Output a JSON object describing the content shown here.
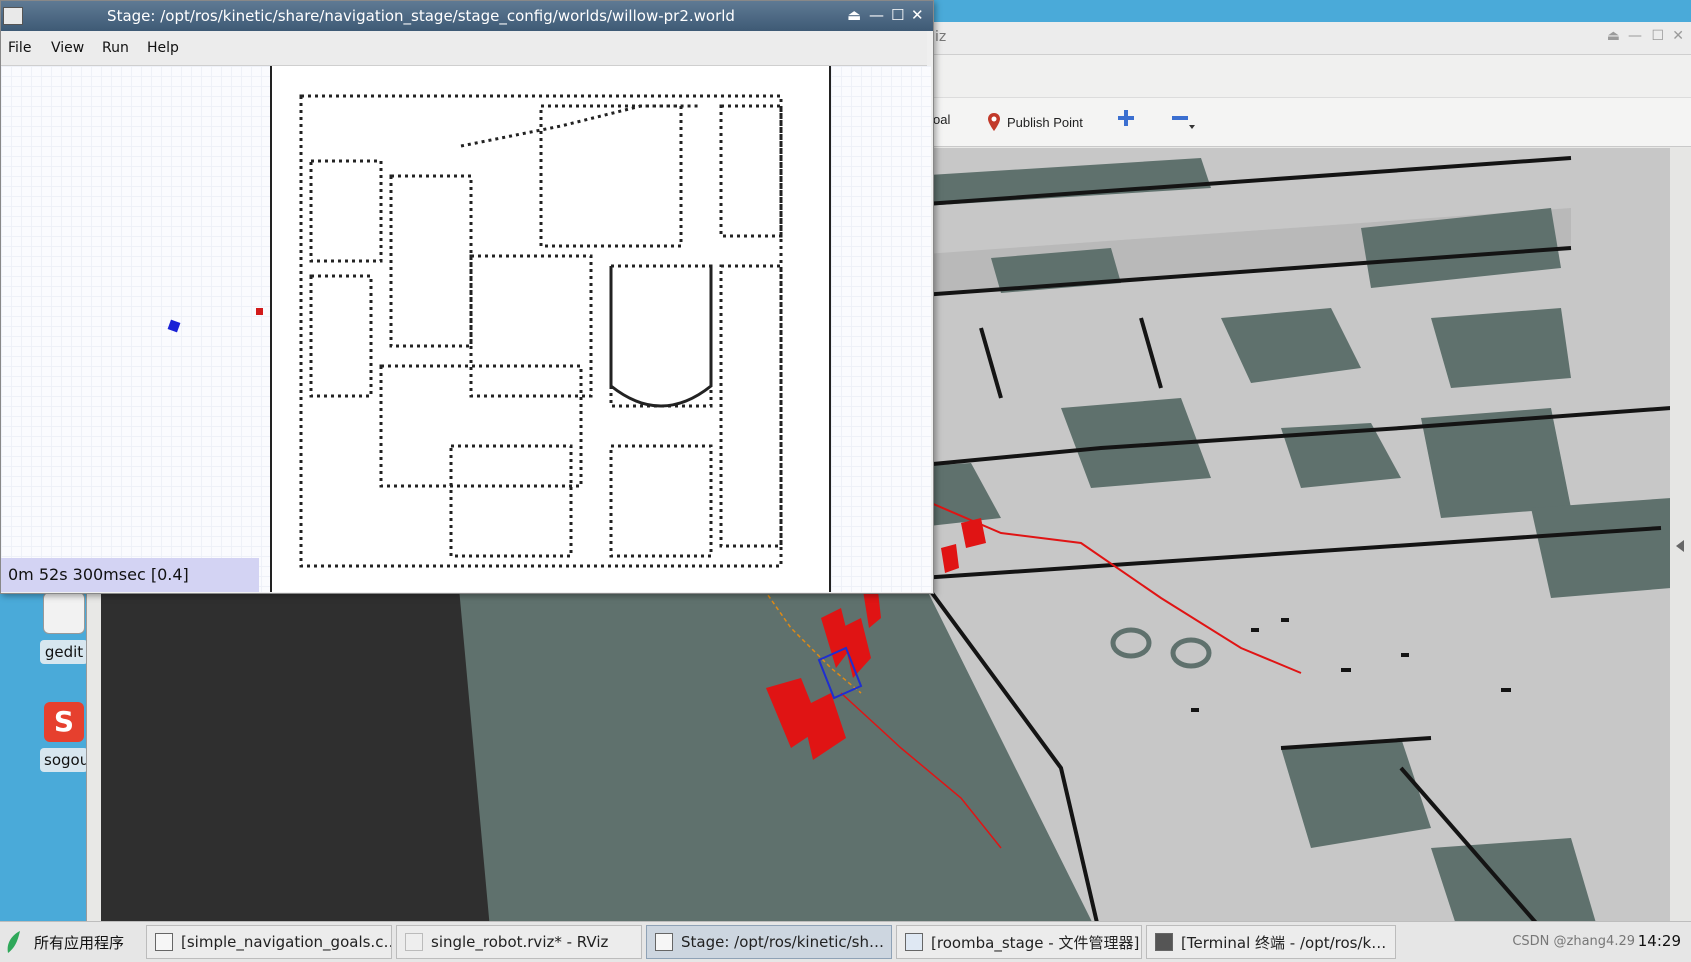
{
  "desktop": {
    "icons": [
      {
        "label": "gedit"
      },
      {
        "label": "sogou"
      }
    ]
  },
  "rviz": {
    "title": "iz",
    "toolbar": {
      "goal_label": "oal",
      "publish_point_label": "Publish Point"
    }
  },
  "stage": {
    "title": "Stage: /opt/ros/kinetic/share/navigation_stage/stage_config/worlds/willow-pr2.world",
    "menu": {
      "file": "File",
      "view": "View",
      "run": "Run",
      "help": "Help"
    },
    "status": "0m 52s 300msec [0.4]"
  },
  "taskbar": {
    "start_label": "所有应用程序",
    "tasks": [
      {
        "label": "[simple_navigation_goals.c…"
      },
      {
        "label": "single_robot.rviz* - RViz"
      },
      {
        "label": "Stage: /opt/ros/kinetic/sh…"
      },
      {
        "label": "[roomba_stage - 文件管理器]"
      },
      {
        "label": "[Terminal 终端 - /opt/ros/k…"
      }
    ],
    "watermark": "CSDN @zhang4.29",
    "clock": "14:29"
  },
  "colors": {
    "desktop_bg": "#4aaad9",
    "map_free": "#c7c7c7",
    "map_unknown": "#5f716d",
    "map_occupied": "#141414",
    "path": "#e01414",
    "robot": "#1f2fd0"
  }
}
